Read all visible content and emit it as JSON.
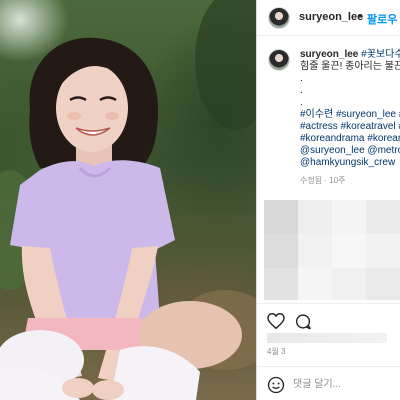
{
  "post": {
    "author": "suryeon_lee",
    "follow_label": "팔로우",
    "separator": "•"
  },
  "caption": {
    "username": "suryeon_lee",
    "lines": [
      "#꽃보다수수",
      "힘줄 울끈! 종아리는 불끈",
      ".",
      ".",
      ".",
      "#이수련 #suryeon_lee #",
      "#actress #koreatravel #",
      "#koreandrama #koreana",
      "@suryeon_lee @metroc",
      "@hamkyungsik_crew"
    ],
    "meta": "수정됨 · 10주"
  },
  "actions": {
    "date": "4월 3"
  },
  "comment_input": {
    "placeholder": "댓글 달기..."
  },
  "colors": {
    "link": "#00376b",
    "follow": "#0095f6",
    "muted": "#8e8e8e",
    "text": "#262626",
    "shirt": "#cdb8ea"
  },
  "icons": [
    "heart-icon",
    "comment-icon",
    "emoji-icon"
  ]
}
